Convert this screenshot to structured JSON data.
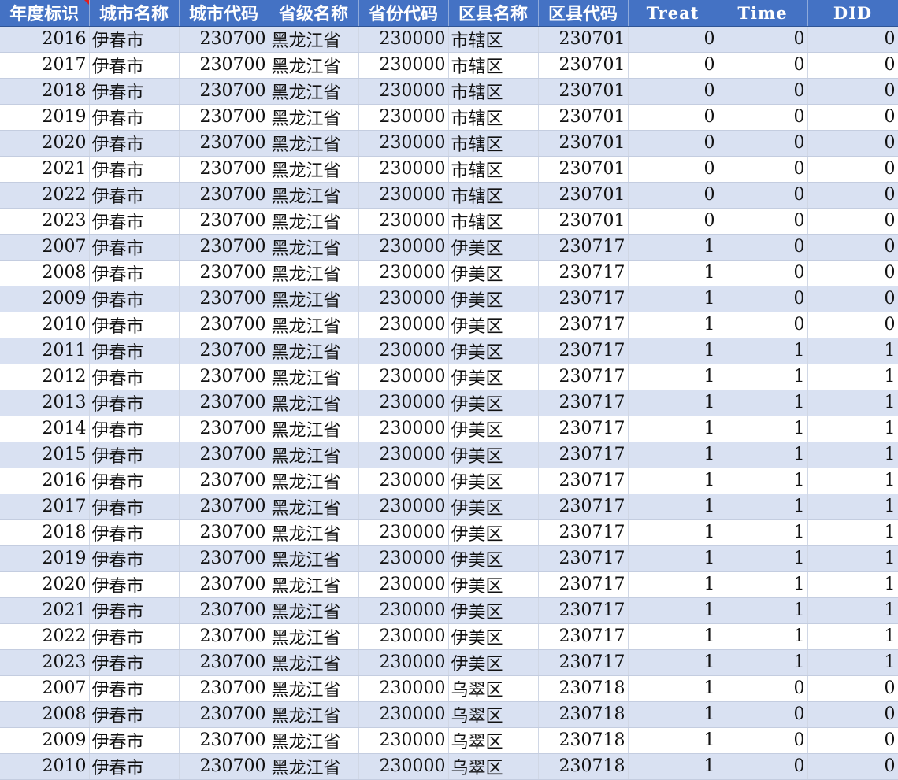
{
  "colors": {
    "header_bg": "#4472c4",
    "header_text": "#ffffff",
    "band_row": "#d9e1f2",
    "plain_row": "#ffffff"
  },
  "columns": [
    "年度标识",
    "城市名称",
    "城市代码",
    "省级名称",
    "省份代码",
    "区县名称",
    "区县代码",
    "Treat",
    "Time",
    "DID"
  ],
  "rows": [
    [
      "2016",
      "伊春市",
      "230700",
      "黑龙江省",
      "230000",
      "市辖区",
      "230701",
      "0",
      "0",
      "0"
    ],
    [
      "2017",
      "伊春市",
      "230700",
      "黑龙江省",
      "230000",
      "市辖区",
      "230701",
      "0",
      "0",
      "0"
    ],
    [
      "2018",
      "伊春市",
      "230700",
      "黑龙江省",
      "230000",
      "市辖区",
      "230701",
      "0",
      "0",
      "0"
    ],
    [
      "2019",
      "伊春市",
      "230700",
      "黑龙江省",
      "230000",
      "市辖区",
      "230701",
      "0",
      "0",
      "0"
    ],
    [
      "2020",
      "伊春市",
      "230700",
      "黑龙江省",
      "230000",
      "市辖区",
      "230701",
      "0",
      "0",
      "0"
    ],
    [
      "2021",
      "伊春市",
      "230700",
      "黑龙江省",
      "230000",
      "市辖区",
      "230701",
      "0",
      "0",
      "0"
    ],
    [
      "2022",
      "伊春市",
      "230700",
      "黑龙江省",
      "230000",
      "市辖区",
      "230701",
      "0",
      "0",
      "0"
    ],
    [
      "2023",
      "伊春市",
      "230700",
      "黑龙江省",
      "230000",
      "市辖区",
      "230701",
      "0",
      "0",
      "0"
    ],
    [
      "2007",
      "伊春市",
      "230700",
      "黑龙江省",
      "230000",
      "伊美区",
      "230717",
      "1",
      "0",
      "0"
    ],
    [
      "2008",
      "伊春市",
      "230700",
      "黑龙江省",
      "230000",
      "伊美区",
      "230717",
      "1",
      "0",
      "0"
    ],
    [
      "2009",
      "伊春市",
      "230700",
      "黑龙江省",
      "230000",
      "伊美区",
      "230717",
      "1",
      "0",
      "0"
    ],
    [
      "2010",
      "伊春市",
      "230700",
      "黑龙江省",
      "230000",
      "伊美区",
      "230717",
      "1",
      "0",
      "0"
    ],
    [
      "2011",
      "伊春市",
      "230700",
      "黑龙江省",
      "230000",
      "伊美区",
      "230717",
      "1",
      "1",
      "1"
    ],
    [
      "2012",
      "伊春市",
      "230700",
      "黑龙江省",
      "230000",
      "伊美区",
      "230717",
      "1",
      "1",
      "1"
    ],
    [
      "2013",
      "伊春市",
      "230700",
      "黑龙江省",
      "230000",
      "伊美区",
      "230717",
      "1",
      "1",
      "1"
    ],
    [
      "2014",
      "伊春市",
      "230700",
      "黑龙江省",
      "230000",
      "伊美区",
      "230717",
      "1",
      "1",
      "1"
    ],
    [
      "2015",
      "伊春市",
      "230700",
      "黑龙江省",
      "230000",
      "伊美区",
      "230717",
      "1",
      "1",
      "1"
    ],
    [
      "2016",
      "伊春市",
      "230700",
      "黑龙江省",
      "230000",
      "伊美区",
      "230717",
      "1",
      "1",
      "1"
    ],
    [
      "2017",
      "伊春市",
      "230700",
      "黑龙江省",
      "230000",
      "伊美区",
      "230717",
      "1",
      "1",
      "1"
    ],
    [
      "2018",
      "伊春市",
      "230700",
      "黑龙江省",
      "230000",
      "伊美区",
      "230717",
      "1",
      "1",
      "1"
    ],
    [
      "2019",
      "伊春市",
      "230700",
      "黑龙江省",
      "230000",
      "伊美区",
      "230717",
      "1",
      "1",
      "1"
    ],
    [
      "2020",
      "伊春市",
      "230700",
      "黑龙江省",
      "230000",
      "伊美区",
      "230717",
      "1",
      "1",
      "1"
    ],
    [
      "2021",
      "伊春市",
      "230700",
      "黑龙江省",
      "230000",
      "伊美区",
      "230717",
      "1",
      "1",
      "1"
    ],
    [
      "2022",
      "伊春市",
      "230700",
      "黑龙江省",
      "230000",
      "伊美区",
      "230717",
      "1",
      "1",
      "1"
    ],
    [
      "2023",
      "伊春市",
      "230700",
      "黑龙江省",
      "230000",
      "伊美区",
      "230717",
      "1",
      "1",
      "1"
    ],
    [
      "2007",
      "伊春市",
      "230700",
      "黑龙江省",
      "230000",
      "乌翠区",
      "230718",
      "1",
      "0",
      "0"
    ],
    [
      "2008",
      "伊春市",
      "230700",
      "黑龙江省",
      "230000",
      "乌翠区",
      "230718",
      "1",
      "0",
      "0"
    ],
    [
      "2009",
      "伊春市",
      "230700",
      "黑龙江省",
      "230000",
      "乌翠区",
      "230718",
      "1",
      "0",
      "0"
    ],
    [
      "2010",
      "伊春市",
      "230700",
      "黑龙江省",
      "230000",
      "乌翠区",
      "230718",
      "1",
      "0",
      "0"
    ]
  ]
}
